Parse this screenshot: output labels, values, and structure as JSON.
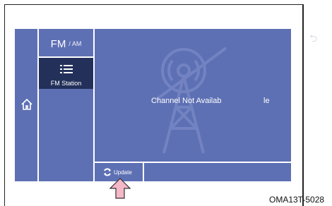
{
  "band": {
    "primary": "FM",
    "secondary": "/ AM"
  },
  "station_button": {
    "label": "FM Station"
  },
  "message": {
    "part1": "Channel Not Availab",
    "part2": "le"
  },
  "update_button": {
    "label": "Update"
  },
  "figure_code": "OMA13T-5028",
  "icons": [
    "home-icon",
    "list-icon",
    "radio-tower-icon",
    "refresh-icon",
    "pointer-arrow-icon",
    "back-icon"
  ],
  "colors": {
    "screen": "#5e70b4",
    "selected": "#22305a",
    "pointer": "#f4b8c8"
  }
}
